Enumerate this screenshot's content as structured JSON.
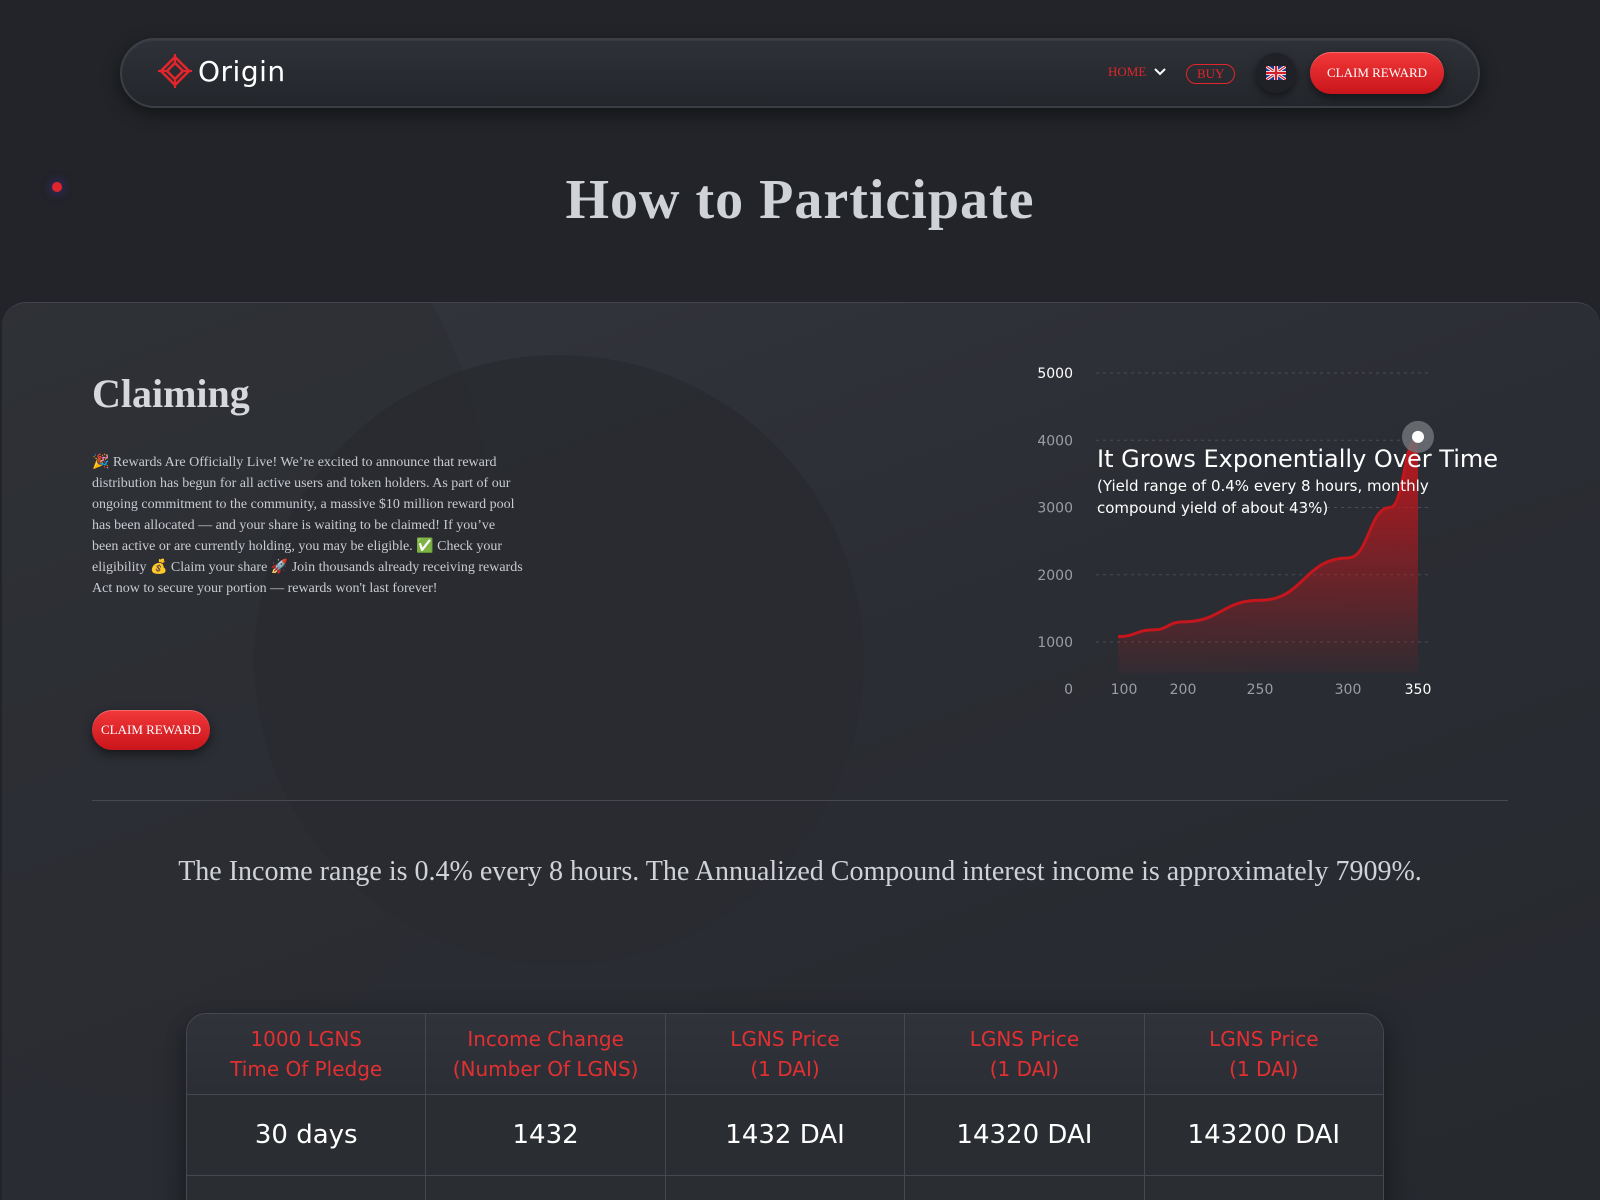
{
  "nav": {
    "logo_text": "Origin",
    "home_label": "HOME",
    "buy_label": "BUY",
    "claim_label": "CLAIM REWARD"
  },
  "page_title": "How to Participate",
  "claiming": {
    "heading": "Claiming",
    "body": "🎉 Rewards Are Officially Live! We’re excited to announce that reward distribution has begun for all active users and token holders. As part of our ongoing commitment to the community, a massive $10 million reward pool has been allocated — and your share is waiting to be claimed! If you’ve been active or are currently holding, you may be eligible. ✅ Check your eligibility 💰 Claim your share 🚀 Join thousands already receiving rewards Act now to secure your portion — rewards won't last forever!",
    "button_label": "CLAIM REWARD"
  },
  "chart_data": {
    "type": "area",
    "title": "It Grows Exponentially Over Time",
    "subtitle": "(Yield range of 0.4% every 8 hours, monthly compound yield of about 43%)",
    "y_ticks": [
      "5000",
      "4000",
      "3000",
      "2000",
      "1000",
      "0"
    ],
    "y_tick_values": [
      5000,
      4000,
      3000,
      2000,
      1000,
      0
    ],
    "x_ticks": [
      "100",
      "200",
      "250",
      "300",
      "350"
    ],
    "x_tick_values": [
      100,
      200,
      250,
      300,
      350
    ],
    "ylim": [
      0,
      5000
    ],
    "xlim": [
      90,
      350
    ],
    "grid": true,
    "series": [
      {
        "x": [
          90,
          150,
          200,
          250,
          300,
          330,
          350
        ],
        "y": [
          1080,
          1180,
          1300,
          1620,
          2250,
          3000,
          4050
        ]
      }
    ],
    "highlight_point": {
      "x": 350,
      "y": 4050
    },
    "color": "#c4161c"
  },
  "income_text": "The Income range is 0.4% every 8 hours. The Annualized Compound interest income is approximately 7909%.",
  "table": {
    "headers": [
      {
        "line1": "1000 LGNS",
        "line2": "Time Of Pledge"
      },
      {
        "line1": "Income Change",
        "line2": "(Number Of LGNS)"
      },
      {
        "line1": "LGNS Price",
        "line2": "(1 DAI)"
      },
      {
        "line1": "LGNS Price",
        "line2": "(1 DAI)"
      },
      {
        "line1": "LGNS Price",
        "line2": "(1 DAI)"
      }
    ],
    "rows": [
      [
        "30 days",
        "1432",
        "1432 DAI",
        "14320 DAI",
        "143200 DAI"
      ]
    ]
  },
  "colors": {
    "accent": "#e0262c",
    "background": "#222429",
    "panel": "#2d3035"
  }
}
